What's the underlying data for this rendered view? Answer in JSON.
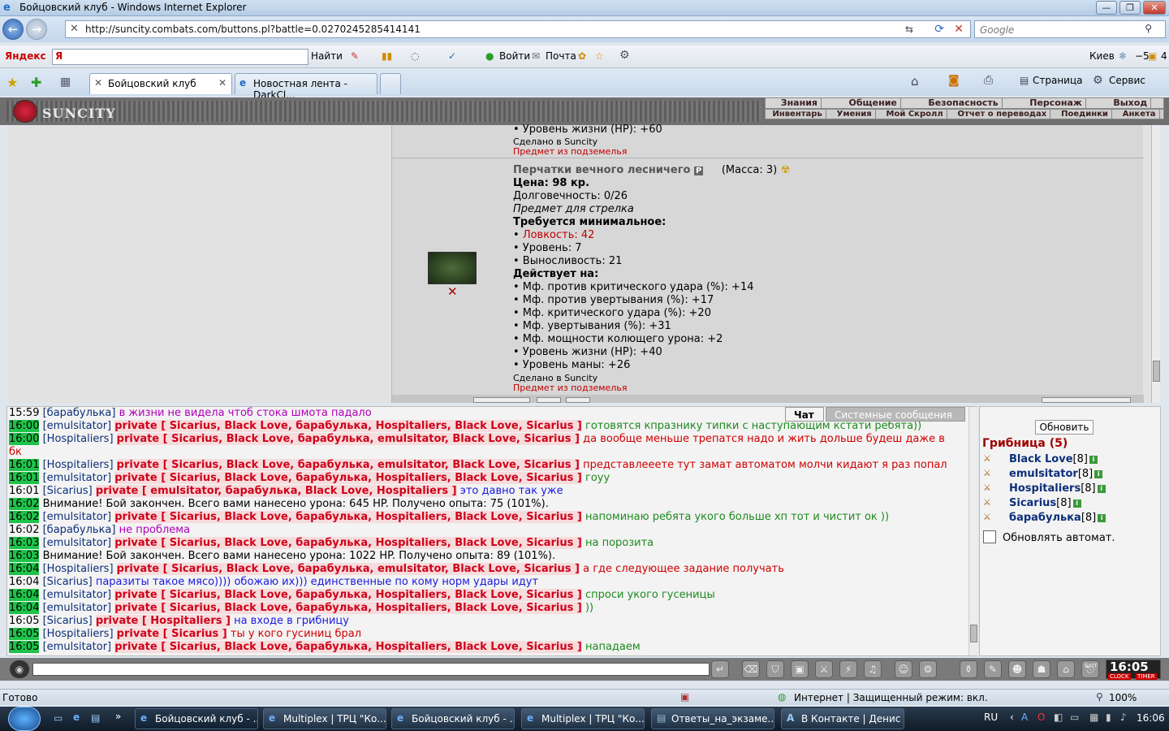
{
  "window": {
    "title": "Бойцовский клуб - Windows Internet Explorer"
  },
  "address": {
    "url": "http://suncity.combats.com/buttons.pl?battle=0.0270245285414141",
    "search_placeholder": "Google"
  },
  "yandex": {
    "brand": "Яндекс",
    "find": "Найти",
    "login": "Войти",
    "mail": "Почта",
    "city": "Киев",
    "temp": "−5",
    "count": "4"
  },
  "tabs": [
    {
      "label": "Бойцовский клуб"
    },
    {
      "label": "Новостная лента - DarkCl..."
    }
  ],
  "ie_tools": {
    "page": "Страница",
    "service": "Сервис"
  },
  "game": {
    "logo": "SUNCITY",
    "menu_top": [
      "Знания",
      "Общение",
      "Безопасность",
      "Персонаж",
      "Выход"
    ],
    "menu_bottom": [
      "Инвентарь",
      "Умения",
      "Мой Скролл",
      "Отчет о переводах",
      "Поединки",
      "Анкета"
    ]
  },
  "prev_item": {
    "line": "• Уровень жизни (HP): +60",
    "made": "Сделано в Suncity",
    "dungeon": "Предмет из подземелья"
  },
  "item": {
    "name": "Перчатки вечного лесничего",
    "badge": "P",
    "mass": "(Масса: 3)",
    "price": "Цена: 98 кр.",
    "durability": "Долговечность: 0/26",
    "for": "Предмет для стрелка",
    "req_title": "Требуется минимальное:",
    "req": [
      "Ловкость: 42",
      "• Уровень: 7",
      "• Выносливость: 21"
    ],
    "acts_title": "Действует на:",
    "acts": [
      "• Мф. против критического удара (%): +14",
      "• Мф. против увертывания (%): +17",
      "• Мф. критического удара (%): +20",
      "• Мф. увертывания (%): +31",
      "• Мф. мощности колющего урона: +2",
      "• Уровень жизни (HP): +40",
      "• Уровень маны: +26"
    ],
    "made": "Сделано в Suncity",
    "dungeon": "Предмет из подземелья",
    "delete_icon": "close-icon"
  },
  "chat": {
    "tab_chat": "Чат",
    "tab_system": "Системные сообщения",
    "lines": [
      {
        "t": "15:59",
        "n": "[барабулька]",
        "p": "",
        "m": "в жизни не видела чтоб стока шмота падало",
        "c": "pk",
        "h": false
      },
      {
        "t": "16:00",
        "n": "[emulsitator]",
        "p": "private [ Sicarius, Black Love, барабулька, Hospitaliers, Black Love, Sicarius ]",
        "m": "готовятся кпразнику типки с наступающим кстати ребята))",
        "c": "gr",
        "h": true
      },
      {
        "t": "16:00",
        "n": "[Hospitaliers]",
        "p": "private [ Sicarius, Black Love, барабулька, emulsitator, Black Love, Sicarius ]",
        "m": "да вообще меньше трепатся надо и жить дольше будеш даже в",
        "c": "warn",
        "h": true
      },
      {
        "t": "",
        "n": "",
        "p": "",
        "m": "бк",
        "c": "warn",
        "h": false
      },
      {
        "t": "16:01",
        "n": "[Hospitaliers]",
        "p": "private [ Sicarius, Black Love, барабулька, emulsitator, Black Love, Sicarius ]",
        "m": "представлееете тут замат автоматом молчи кидают я раз попал",
        "c": "warn",
        "h": true
      },
      {
        "t": "16:01",
        "n": "[emulsitator]",
        "p": "private [ Sicarius, Black Love, барабулька, Hospitaliers, Black Love, Sicarius ]",
        "m": "гоуу",
        "c": "gr",
        "h": true
      },
      {
        "t": "16:01",
        "n": "[Sicarius]",
        "p": "private [ emulsitator, барабулька, Black Love, Hospitaliers ]",
        "m": "это давно так уже",
        "c": "bl",
        "h": false
      },
      {
        "t": "16:02",
        "n": "",
        "p": "",
        "m": "Внимание! Бой закончен. Всего вами нанесено урона: 645 HP. Получено опыта: 75 (101%).",
        "c": "sys",
        "h": true
      },
      {
        "t": "16:02",
        "n": "[emulsitator]",
        "p": "private [ Sicarius, Black Love, барабулька, Hospitaliers, Black Love, Sicarius ]",
        "m": "напоминаю ребята укого больше хп тот и чистит ок ))",
        "c": "gr",
        "h": true
      },
      {
        "t": "16:02",
        "n": "[барабулька]",
        "p": "",
        "m": "не проблема",
        "c": "pk",
        "h": false
      },
      {
        "t": "16:03",
        "n": "[emulsitator]",
        "p": "private [ Sicarius, Black Love, барабулька, Hospitaliers, Black Love, Sicarius ]",
        "m": "на порозита",
        "c": "gr",
        "h": true
      },
      {
        "t": "16:03",
        "n": "",
        "p": "",
        "m": "Внимание! Бой закончен. Всего вами нанесено урона: 1022 HP. Получено опыта: 89 (101%).",
        "c": "sys",
        "h": true
      },
      {
        "t": "16:04",
        "n": "[Hospitaliers]",
        "p": "private [ Sicarius, Black Love, барабулька, emulsitator, Black Love, Sicarius ]",
        "m": "а где следующее задание получать",
        "c": "warn",
        "h": true
      },
      {
        "t": "16:04",
        "n": "[Sicarius]",
        "p": "",
        "m": "паразиты такое мясо)))) обожаю их))) единственные по кому норм удары идут",
        "c": "bl",
        "h": false
      },
      {
        "t": "16:04",
        "n": "[emulsitator]",
        "p": "private [ Sicarius, Black Love, барабулька, Hospitaliers, Black Love, Sicarius ]",
        "m": "спроси укого гусеницы",
        "c": "gr",
        "h": true
      },
      {
        "t": "16:04",
        "n": "[emulsitator]",
        "p": "private [ Sicarius, Black Love, барабулька, Hospitaliers, Black Love, Sicarius ]",
        "m": "))",
        "c": "gr",
        "h": true
      },
      {
        "t": "16:05",
        "n": "[Sicarius]",
        "p": "private [ Hospitaliers ]",
        "m": "на входе в грибницу",
        "c": "bl",
        "h": false
      },
      {
        "t": "16:05",
        "n": "[Hospitaliers]",
        "p": "private [ Sicarius ]",
        "m": "ты у кого гусиниц брал",
        "c": "warn",
        "h": true
      },
      {
        "t": "16:05",
        "n": "[emulsitator]",
        "p": "private [ Sicarius, Black Love, барабулька, Hospitaliers, Black Love, Sicarius ]",
        "m": "нападаем",
        "c": "gr",
        "h": true
      }
    ]
  },
  "room": {
    "refresh": "Обновить",
    "title": "Грибница (5)",
    "users": [
      {
        "name": "Black Love",
        "level": "[8]"
      },
      {
        "name": "emulsitator",
        "level": "[8]"
      },
      {
        "name": "Hospitaliers",
        "level": "[8]"
      },
      {
        "name": "Sicarius",
        "level": "[8]"
      },
      {
        "name": "барабулька",
        "level": "[8]"
      }
    ],
    "auto": "Обновлять автомат."
  },
  "clock": {
    "time": "16:05",
    "sub1": "CLOCK",
    "sub2": "TIMER",
    "exit": "EXIT"
  },
  "status": {
    "ready": "Готово",
    "zone": "Интернет | Защищенный режим: вкл.",
    "zoom": "100%"
  },
  "taskbar": {
    "items": [
      "Бойцовский клуб - ...",
      "Multiplex | ТРЦ \"Ко...",
      "Бойцовский клуб - ...",
      "Multiplex | ТРЦ \"Ко...",
      "Ответы_на_экзаме...",
      "В Контакте | Денис ..."
    ],
    "lang": "RU",
    "time": "16:06"
  }
}
